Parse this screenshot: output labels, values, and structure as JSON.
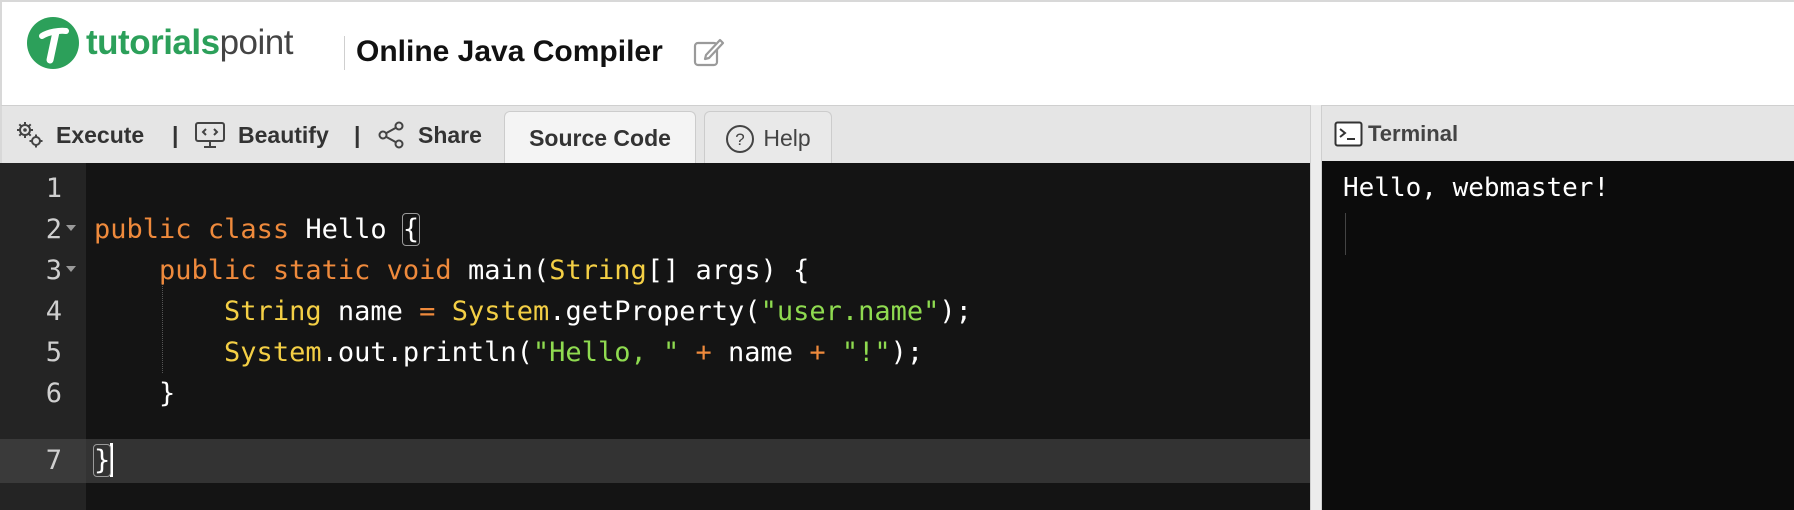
{
  "header": {
    "logo_bold": "tutorials",
    "logo_light": "point",
    "title": "Online Java Compiler"
  },
  "toolbar": {
    "execute": "Execute",
    "beautify": "Beautify",
    "share": "Share",
    "separator": "|",
    "tabs": [
      {
        "label": "Source Code",
        "active": true
      },
      {
        "label": "Help",
        "active": false
      }
    ]
  },
  "editor": {
    "line_numbers": [
      "1",
      "2",
      "3",
      "4",
      "5",
      "6",
      "7"
    ],
    "active_line": 7,
    "tokens": {
      "l2": [
        "public",
        "class",
        "Hello",
        "{"
      ],
      "l3": [
        "public",
        "static",
        "void",
        "main(",
        "String",
        "[] args) {"
      ],
      "l4": [
        "String",
        "name",
        "=",
        "System",
        ".getProperty(",
        "\"user.name\"",
        ");"
      ],
      "l5": [
        "System",
        ".out.println(",
        "\"Hello, \"",
        "+",
        "name",
        "+",
        "\"!\"",
        ");"
      ],
      "l6": "}",
      "l7": "}"
    }
  },
  "terminal": {
    "title": "Terminal",
    "output": "Hello, webmaster!"
  },
  "colors": {
    "brand": "#2ca05a",
    "keyword": "#ef8a3c",
    "type": "#f4cf45",
    "string": "#8fdb50"
  },
  "icons": [
    "gears-icon",
    "monitor-code-icon",
    "share-icon",
    "help-icon",
    "terminal-icon",
    "edit-icon",
    "logo-icon"
  ]
}
